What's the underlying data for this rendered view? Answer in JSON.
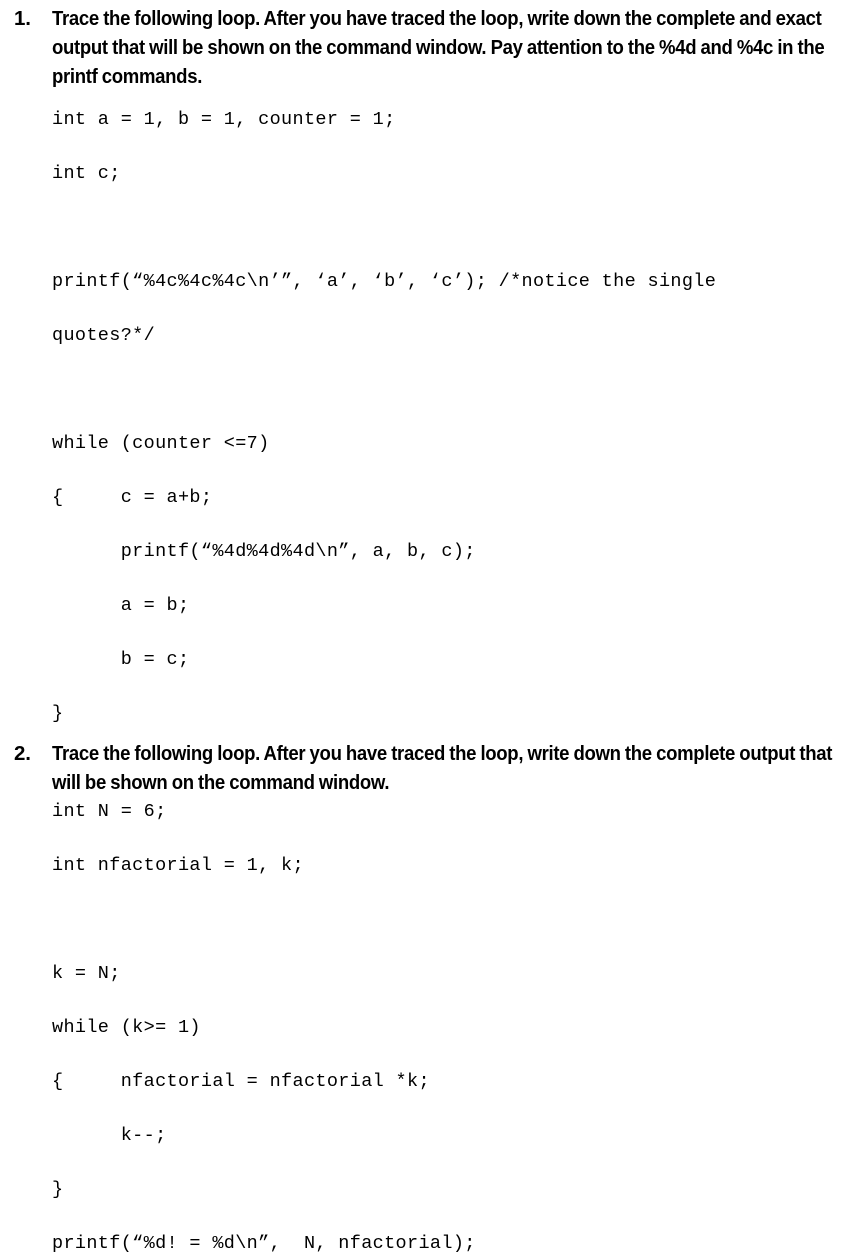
{
  "document": {
    "background_color": "#ffffff",
    "text_color": "#000000"
  },
  "questions": [
    {
      "marker": "1.",
      "prompt": "Trace the following loop. After you have traced the loop, write down the complete and exact output that will be shown on the command window. Pay attention to the %4d and %4c in the printf commands.",
      "code_lines": [
        "int a = 1, b = 1, counter = 1;",
        "int c;",
        "",
        "printf(“%4c%4c%4c\\n’”, ‘a’, ‘b’, ‘c’); /*notice the single",
        "quotes?*/",
        "",
        "while (counter <=7)",
        "{     c = a+b;",
        "      printf(“%4d%4d%4d\\n”, a, b, c);",
        "      a = b;",
        "      b = c;",
        "}"
      ]
    },
    {
      "marker": "2.",
      "prompt": "Trace the following loop. After you have traced the loop, write down the complete output that will be shown on the command window.",
      "code_lines": [
        "int N = 6;",
        "int nfactorial = 1, k;",
        "",
        "k = N;",
        "while (k>= 1)",
        "{     nfactorial = nfactorial *k;",
        "      k--;",
        "}",
        "printf(“%d! = %d\\n”,  N, nfactorial);"
      ]
    }
  ]
}
